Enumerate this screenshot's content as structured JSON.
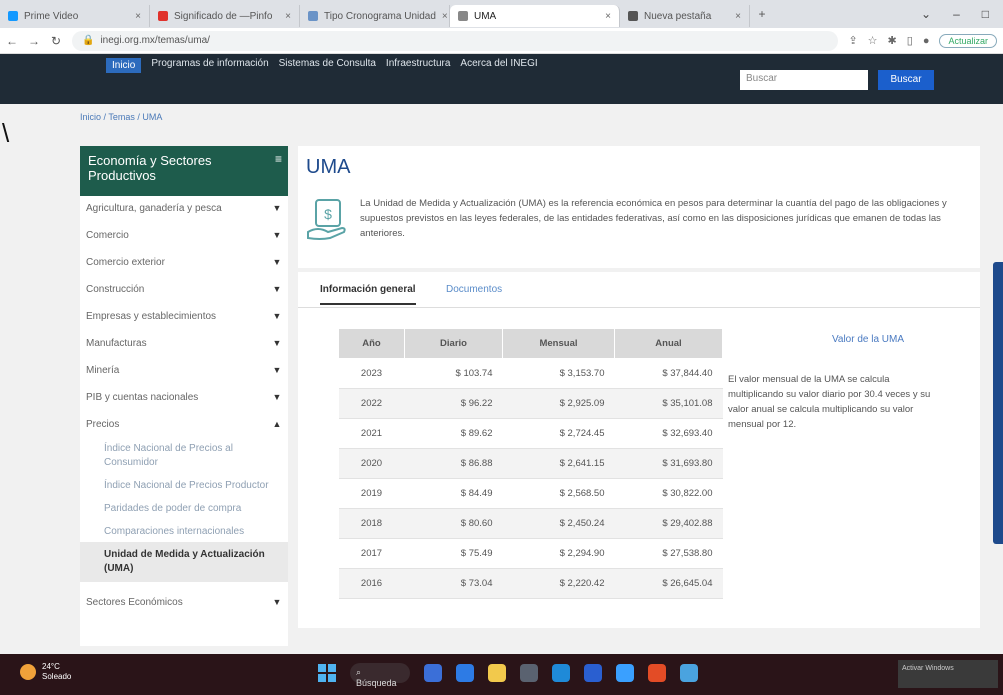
{
  "browser": {
    "tabs": [
      {
        "label": "Prime Video",
        "color": "#1399ff",
        "active": false
      },
      {
        "label": "Significado de —Pinfo",
        "color": "#e0322c",
        "active": false
      },
      {
        "label": "Tipo Cronograma Unidad",
        "color": "#6a93c7",
        "active": false
      },
      {
        "label": "UMA",
        "color": "#888888",
        "active": true
      },
      {
        "label": "Nueva pestaña",
        "color": "#555555",
        "active": false
      }
    ],
    "url": "inegi.org.mx/temas/uma/",
    "profile_label": "Actualizar"
  },
  "site": {
    "nav": [
      "Inicio",
      "Programas de información",
      "Sistemas de Consulta",
      "Infraestructura",
      "Acerca del INEGI"
    ],
    "search_placeholder": "Buscar",
    "search_button": "Buscar",
    "breadcrumb": "Inicio / Temas / UMA"
  },
  "sidebar": {
    "title": "Economía y Sectores Productivos",
    "items": [
      {
        "label": "Agricultura, ganadería y pesca",
        "expanded": false
      },
      {
        "label": "Comercio",
        "expanded": false
      },
      {
        "label": "Comercio exterior",
        "expanded": false
      },
      {
        "label": "Construcción",
        "expanded": false
      },
      {
        "label": "Empresas y establecimientos",
        "expanded": false
      },
      {
        "label": "Manufacturas",
        "expanded": false
      },
      {
        "label": "Minería",
        "expanded": false
      },
      {
        "label": "PIB y cuentas nacionales",
        "expanded": false
      },
      {
        "label": "Precios",
        "expanded": true
      }
    ],
    "subitems": [
      "Índice Nacional de Precios al Consumidor",
      "Índice Nacional de Precios Productor",
      "Paridades de poder de compra",
      "Comparaciones internacionales",
      "Unidad de Medida y Actualización (UMA)"
    ],
    "last_item": "Sectores Económicos"
  },
  "main": {
    "title": "UMA",
    "description": "La Unidad de Medida y Actualización (UMA) es la referencia económica en pesos para determinar la cuantía del pago de las obligaciones y supuestos previstos en las leyes federales, de las entidades federativas, así como en las disposiciones jurídicas que emanen de todas las anteriores.",
    "tabs": [
      "Información general",
      "Documentos"
    ],
    "table": {
      "headers": [
        "Año",
        "Diario",
        "Mensual",
        "Anual"
      ],
      "rows": [
        [
          "2023",
          "$ 103.74",
          "$ 3,153.70",
          "$ 37,844.40"
        ],
        [
          "2022",
          "$ 96.22",
          "$ 2,925.09",
          "$ 35,101.08"
        ],
        [
          "2021",
          "$ 89.62",
          "$ 2,724.45",
          "$ 32,693.40"
        ],
        [
          "2020",
          "$ 86.88",
          "$ 2,641.15",
          "$ 31,693.80"
        ],
        [
          "2019",
          "$ 84.49",
          "$ 2,568.50",
          "$ 30,822.00"
        ],
        [
          "2018",
          "$ 80.60",
          "$ 2,450.24",
          "$ 29,402.88"
        ],
        [
          "2017",
          "$ 75.49",
          "$ 2,294.90",
          "$ 27,538.80"
        ],
        [
          "2016",
          "$ 73.04",
          "$ 2,220.42",
          "$ 26,645.04"
        ]
      ]
    },
    "side_title": "Valor de la UMA",
    "side_note": "El valor mensual de la UMA se calcula multiplicando su valor diario por 30.4 veces y su valor anual se calcula multiplicando su valor mensual por 12."
  },
  "taskbar": {
    "weather_temp": "24°C",
    "weather_desc": "Soleado",
    "search_label": "Búsqueda",
    "corner_text": "Activar Windows"
  }
}
